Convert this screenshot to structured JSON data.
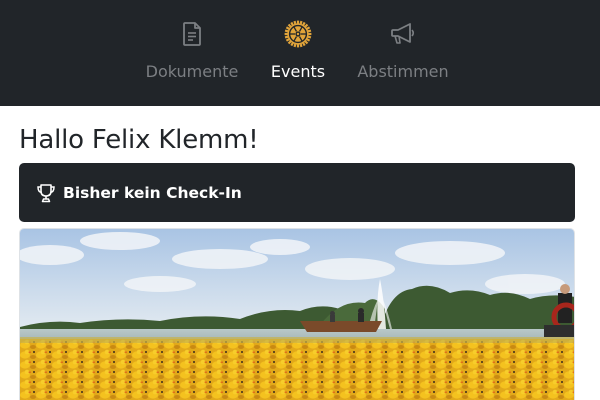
{
  "nav": {
    "items": [
      {
        "label": "Dokumente",
        "icon": "document-icon",
        "active": false
      },
      {
        "label": "Events",
        "icon": "rotary-wheel-icon",
        "active": true
      },
      {
        "label": "Abstimmen",
        "icon": "megaphone-icon",
        "active": false
      }
    ]
  },
  "greeting": "Hallo Felix Klemm!",
  "checkin": {
    "icon": "trophy-icon",
    "text": "Bisher kein Check-In"
  },
  "event": {
    "image": "rubber-duck-race-photo"
  },
  "colors": {
    "navbar": "#212529",
    "nav_inactive": "#7c7f83",
    "nav_active": "#ffffff",
    "rotary_gold": "#e1a43a",
    "card": "#212529"
  }
}
